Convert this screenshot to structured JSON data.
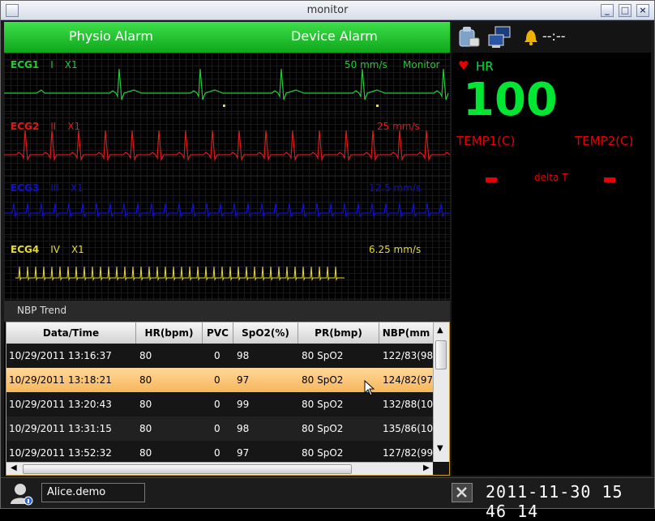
{
  "window": {
    "title": "monitor",
    "min_label": "_",
    "max_label": "□",
    "close_label": "×"
  },
  "alarms": {
    "physio": "Physio Alarm",
    "device": "Device Alarm"
  },
  "ecg": [
    {
      "name": "ECG1",
      "lead": "I",
      "gain": "X1",
      "speed": "50 mm/s",
      "mode": "Monitor",
      "color": "#22cc33"
    },
    {
      "name": "ECG2",
      "lead": "II",
      "gain": "X1",
      "speed": "25 mm/s",
      "mode": "",
      "color": "#e01818"
    },
    {
      "name": "ECG3",
      "lead": "III",
      "gain": "X1",
      "speed": "12.5 mm/s",
      "mode": "",
      "color": "#1010d0"
    },
    {
      "name": "ECG4",
      "lead": "IV",
      "gain": "X1",
      "speed": "6.25 mm/s",
      "mode": "",
      "color": "#e8dc30"
    }
  ],
  "nbp": {
    "title": "NBP Trend",
    "columns": [
      "Data/Time",
      "HR(bpm)",
      "PVC",
      "SpO2(%)",
      "PR(bmp)",
      "NBP(mm"
    ],
    "rows": [
      [
        "10/29/2011 13:16:37",
        "80",
        "0",
        "98",
        "80 SpO2",
        "122/83(98"
      ],
      [
        "10/29/2011 13:18:21",
        "80",
        "0",
        "97",
        "80 SpO2",
        "124/82(97"
      ],
      [
        "10/29/2011 13:20:43",
        "80",
        "0",
        "99",
        "80 SpO2",
        "132/88(10"
      ],
      [
        "10/29/2011 13:31:15",
        "80",
        "0",
        "98",
        "80 SpO2",
        "135/86(10"
      ],
      [
        "10/29/2011 13:52:32",
        "80",
        "0",
        "97",
        "80 SpO2",
        "127/82(99"
      ]
    ],
    "selected_row": 1
  },
  "status": {
    "alarm_time": "--:--",
    "icons": [
      "patient-monitor-icon",
      "network-computers-icon",
      "alarm-bell-icon"
    ]
  },
  "vitals": {
    "hr_label": "HR",
    "hr_value": "100",
    "temp1_label": "TEMP1(C)",
    "temp2_label": "TEMP2(C)",
    "delta_label": "delta T",
    "colors": {
      "hr": "#00e632",
      "temp": "#e60000"
    }
  },
  "footer": {
    "user": "Alice.demo",
    "datetime": "2011-11-30 15 46 14"
  }
}
